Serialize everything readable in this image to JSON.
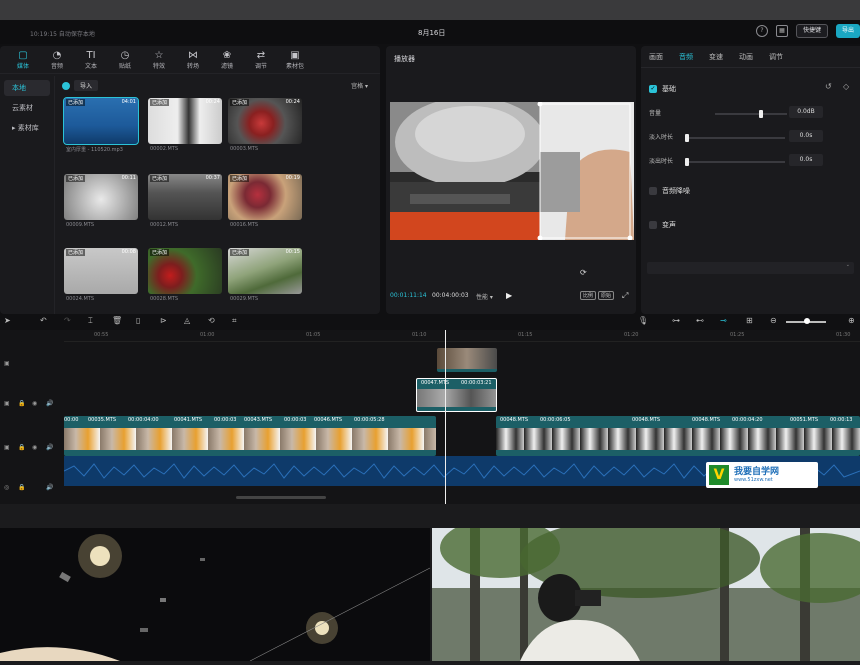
{
  "titlebar": {
    "status": "10:19:15 自动保存本地",
    "date": "8月16日",
    "shortcut": "快捷键",
    "export": "导出"
  },
  "toolbar": [
    {
      "label": "媒体",
      "icon": "▢"
    },
    {
      "label": "音频",
      "icon": "◔"
    },
    {
      "label": "文本",
      "icon": "TI"
    },
    {
      "label": "贴纸",
      "icon": "◷"
    },
    {
      "label": "特效",
      "icon": "☆"
    },
    {
      "label": "转场",
      "icon": "⋈"
    },
    {
      "label": "滤镜",
      "icon": "❀"
    },
    {
      "label": "调节",
      "icon": "⇄"
    },
    {
      "label": "素材包",
      "icon": "▣"
    }
  ],
  "sidebar": [
    {
      "label": "本地"
    },
    {
      "label": "云素材"
    },
    {
      "label": "▸ 素材库"
    }
  ],
  "media_head": {
    "import": "导入",
    "view": "宫格 ▾"
  },
  "media": [
    {
      "tag": "已添加",
      "dur": "04:01",
      "name": "室内厚重 - 110520.mp3"
    },
    {
      "tag": "已添加",
      "dur": "00:24",
      "name": "00002.MTS"
    },
    {
      "tag": "已添加",
      "dur": "00:24",
      "name": "00003.MTS"
    },
    {
      "tag": "已添加",
      "dur": "00:11",
      "name": "00009.MTS"
    },
    {
      "tag": "已添加",
      "dur": "00:37",
      "name": "00012.MTS"
    },
    {
      "tag": "已添加",
      "dur": "00:19",
      "name": "00016.MTS"
    },
    {
      "tag": "已添加",
      "dur": "00:08",
      "name": "00024.MTS"
    },
    {
      "tag": "已添加",
      "dur": "",
      "name": "00028.MTS"
    },
    {
      "tag": "已添加",
      "dur": "00:15",
      "name": "00029.MTS"
    }
  ],
  "player": {
    "title": "播放器",
    "current": "00:01:11:14",
    "total": "00:04:00:03",
    "quality": "性能 ▾",
    "ratio_btn": "比例",
    "full_btn": "原始"
  },
  "props": {
    "tabs": [
      "画面",
      "音频",
      "变速",
      "动画",
      "调节"
    ],
    "basic": "基础",
    "volume": "音量",
    "volume_val": "0.0dB",
    "fade_in": "淡入时长",
    "fade_in_val": "0.0s",
    "fade_out": "淡出时长",
    "fade_out_val": "0.0s",
    "noise": "音频降噪",
    "voice": "变声"
  },
  "ruler": [
    "00:55",
    "01:00",
    "01:05",
    "01:10",
    "01:15",
    "01:20",
    "01:25",
    "01:30"
  ],
  "clips": {
    "sel_name": "00047.MTS",
    "sel_dur": "00:00:03:21",
    "main_left": [
      {
        "n": "00:00",
        "d": ""
      },
      {
        "n": "00035.MTS",
        "d": "00:00:04:00"
      },
      {
        "n": "00041.MTS",
        "d": "00:00:03"
      },
      {
        "n": "00043.MTS",
        "d": "00:00:03"
      },
      {
        "n": "00046.MTS",
        "d": "00:00:05:28"
      }
    ],
    "main_right": [
      {
        "n": "00048.MTS",
        "d": "00:00:06:05"
      },
      {
        "n": "00048.MTS",
        "d": ""
      },
      {
        "n": "00048.MTS",
        "d": "00:00:04:20"
      },
      {
        "n": "00051.MTS",
        "d": "00:00:13"
      }
    ]
  },
  "watermark": {
    "text": "我要自学网",
    "url": "www.51zxw.net"
  },
  "colors": {
    "accent": "#2bc3d8",
    "clip_teal": "#1c5f66",
    "audio_blue": "#0e3a6a"
  }
}
